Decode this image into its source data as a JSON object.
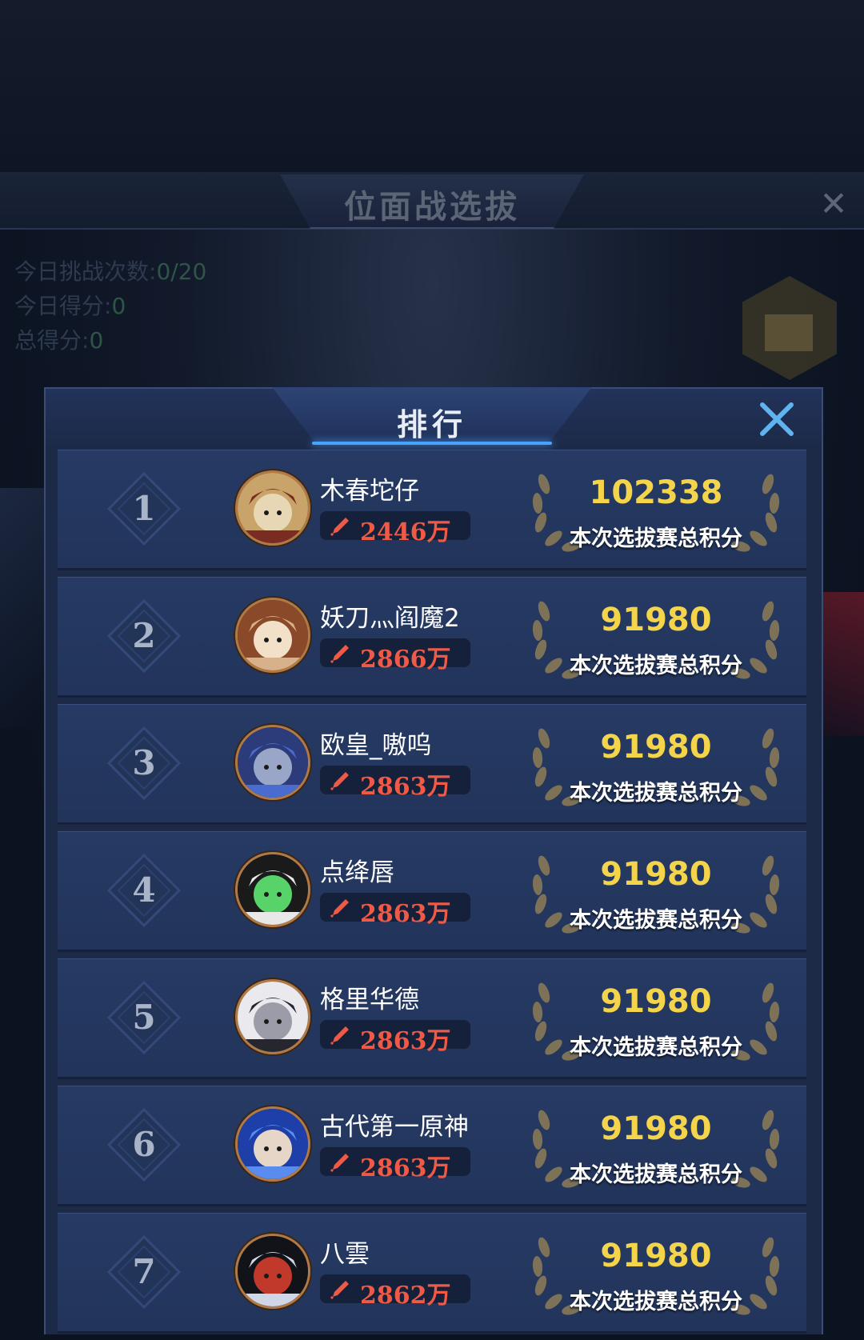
{
  "background": {
    "title": "位面战选拔",
    "stats": [
      {
        "label": "今日挑战次数:",
        "value": "0/20"
      },
      {
        "label": "今日得分:",
        "value": "0"
      },
      {
        "label": "总得分:",
        "value": "0"
      }
    ]
  },
  "panel": {
    "title": "排行"
  },
  "ranking": [
    {
      "rank": "1",
      "name": "木春坨仔",
      "power": "2446万",
      "score": "102338",
      "score_label": "本次选拔赛总积分",
      "avatar": "bishop-avatar"
    },
    {
      "rank": "2",
      "name": "妖刀灬阎魔2",
      "power": "2866万",
      "score": "91980",
      "score_label": "本次选拔赛总积分",
      "avatar": "girl-avatar"
    },
    {
      "rank": "3",
      "name": "欧皇_嗷呜",
      "power": "2863万",
      "score": "91980",
      "score_label": "本次选拔赛总积分",
      "avatar": "wolf-avatar"
    },
    {
      "rank": "4",
      "name": "点绛唇",
      "power": "2863万",
      "score": "91980",
      "score_label": "本次选拔赛总积分",
      "avatar": "panda-avatar"
    },
    {
      "rank": "5",
      "name": "格里华德",
      "power": "2863万",
      "score": "91980",
      "score_label": "本次选拔赛总积分",
      "avatar": "white-hair-avatar"
    },
    {
      "rank": "6",
      "name": "古代第一原神",
      "power": "2863万",
      "score": "91980",
      "score_label": "本次选拔赛总积分",
      "avatar": "blue-hair-avatar"
    },
    {
      "rank": "7",
      "name": "八雲",
      "power": "2862万",
      "score": "91980",
      "score_label": "本次选拔赛总积分",
      "avatar": "demon-avatar"
    }
  ],
  "colors": {
    "score": "#f4d44b",
    "power": "#ef5a47",
    "avatar_ring": "#b17a45",
    "panel": "#1c2a47"
  }
}
